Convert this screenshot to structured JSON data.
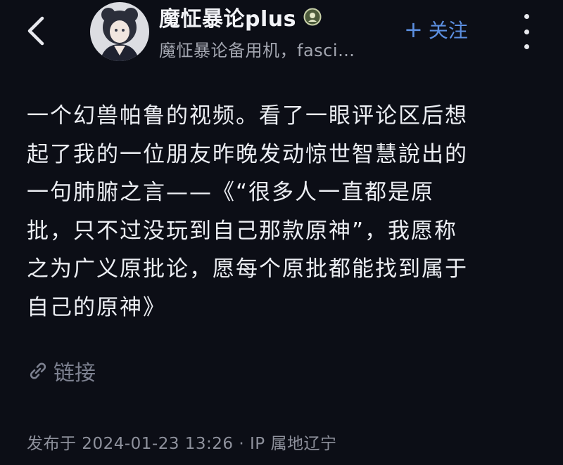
{
  "header": {
    "user_name": "魔怔暴论plus",
    "subtitle": "魔怔暴论备用机，fasci…",
    "follow_plus": "+",
    "follow_label": "关注",
    "icons": [
      "back-arrow-icon",
      "avatar",
      "verified-badge-icon",
      "more-vert-icon"
    ]
  },
  "post": {
    "text": "一个幻兽帕鲁的视频。看了一眼评论区后想\n起了我的一位朋友昨晚发动惊世智慧說出的\n一句肺腑之言——《“很多人一直都是原\n批，只不过没玩到自己那款原神”，我愿称\n之为广义原批论，愿每个原批都能找到属于\n自己的原神》",
    "link_label": "链接",
    "meta": "发布于 2024-01-23 13:26 · IP 属地辽宁"
  },
  "colors": {
    "background": "#0c0e16",
    "accent": "#5c8fe0",
    "text_primary": "#eceef3",
    "text_secondary": "#a3a6b0"
  }
}
